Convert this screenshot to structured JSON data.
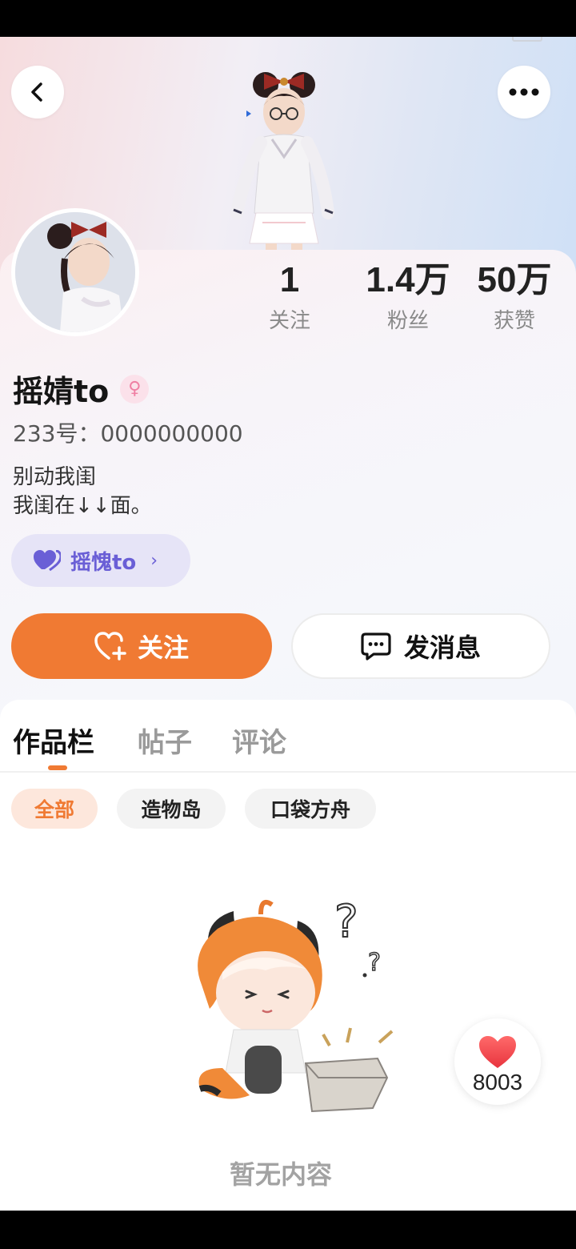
{
  "header": {
    "back_icon": "chevron-left-icon",
    "more_icon": "more-dots-icon"
  },
  "stats": [
    {
      "value": "1",
      "label": "关注"
    },
    {
      "value": "1.4万",
      "label": "粉丝"
    },
    {
      "value": "50万",
      "label": "获赞"
    }
  ],
  "profile": {
    "username": "摇婧to",
    "gender_symbol": "♀",
    "account_id": "233号：0000000000",
    "bio": "别动我闺\n我闺在↓↓面。"
  },
  "relation_tag": {
    "label": "摇愧to",
    "icon": "heart-pair-icon",
    "chevron": "›"
  },
  "actions": {
    "follow_label": "关注",
    "message_label": "发消息"
  },
  "tabs": [
    {
      "label": "作品栏",
      "active": true
    },
    {
      "label": "帖子",
      "active": false
    },
    {
      "label": "评论",
      "active": false
    }
  ],
  "filters": [
    {
      "label": "全部",
      "active": true
    },
    {
      "label": "造物岛",
      "active": false
    },
    {
      "label": "口袋方舟",
      "active": false
    }
  ],
  "empty_state": {
    "text": "暂无内容"
  },
  "like_button": {
    "count": "8003"
  },
  "colors": {
    "accent": "#f07a33",
    "tag_purple": "#6a5fd6"
  }
}
